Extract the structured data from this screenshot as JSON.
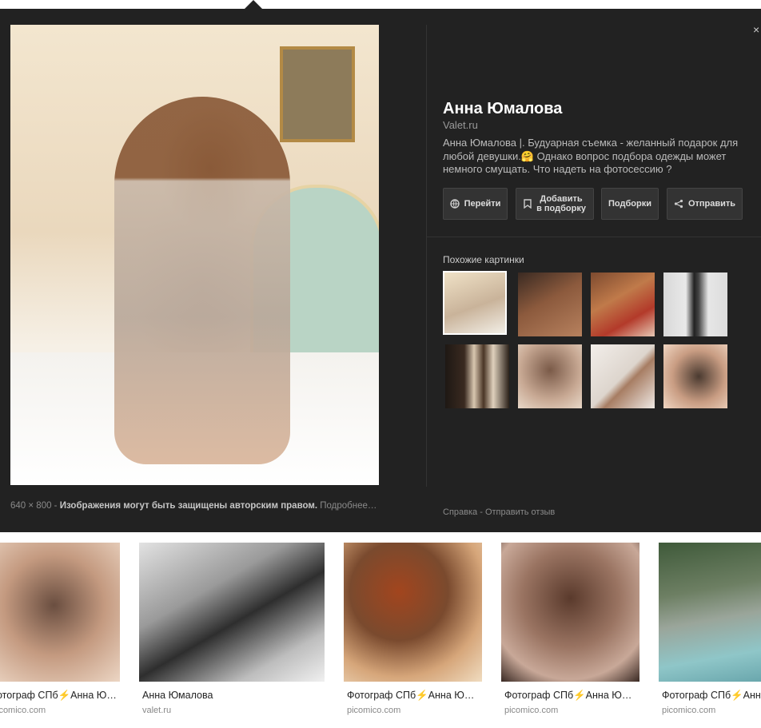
{
  "detail": {
    "title": "Анна Юмалова",
    "domain": "Valet.ru",
    "description": "Анна Юмалова |. Будуарная съемка - желанный подарок для любой девушки.🤗 Однако вопрос подбора одежды может немного смущать. Что надеть на фотосессию ?",
    "actions": [
      {
        "label": "Перейти",
        "icon": "globe-icon"
      },
      {
        "label": "Добавить\nв подборку",
        "icon": "bookmark-icon"
      },
      {
        "label": "Подборки",
        "icon": ""
      },
      {
        "label": "Отправить",
        "icon": "share-icon"
      }
    ],
    "similar_label": "Похожие картинки",
    "close_glyph": "×"
  },
  "footer": {
    "dimensions": "640 × 800",
    "separator": " - ",
    "copyright": "Изображения могут быть защищены авторским правом.",
    "more": "Подробнее…",
    "help": "Справка",
    "dot": " - ",
    "feedback": "Отправить отзыв"
  },
  "results": [
    {
      "title": "отограф СПб⚡️Анна Ю…",
      "site": "icomico.com"
    },
    {
      "title": "Анна Юмалова",
      "site": "valet.ru"
    },
    {
      "title": "Фотограф СПб⚡️Анна Ю…",
      "site": "picomico.com"
    },
    {
      "title": "Фотограф СПб⚡️Анна Ю…",
      "site": "picomico.com"
    },
    {
      "title": "Фотограф СПб⚡️Анна",
      "site": "picomico.com"
    }
  ],
  "colors": {
    "panel_bg": "#222222",
    "button_bg": "#333333",
    "title_text": "#ffffff",
    "body_text": "#bbbbbb"
  }
}
